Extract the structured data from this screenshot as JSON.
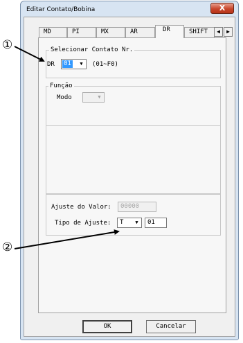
{
  "window": {
    "title": "Editar Contato/Bobina",
    "close_symbol": "X"
  },
  "tabs": [
    {
      "label": "MD",
      "active": false
    },
    {
      "label": "PI",
      "active": false
    },
    {
      "label": "MX",
      "active": false
    },
    {
      "label": "AR",
      "active": false
    },
    {
      "label": "DR",
      "active": true
    },
    {
      "label": "SHIFT",
      "active": false
    }
  ],
  "tab_scroll": {
    "left_icon": "◀",
    "right_icon": "▶"
  },
  "select_contact": {
    "legend": "Selecionar Contato Nr.",
    "prefix": "DR",
    "value": "01",
    "dropdown_icon": "▼",
    "range": "(01~F0)"
  },
  "function": {
    "legend": "Função",
    "mode_label": "Modo",
    "mode_value": "",
    "dropdown_icon": "▼"
  },
  "adjust": {
    "value_label": "Ajuste do Valor:",
    "value_placeholder": "00000",
    "type_label": "Tipo de Ajuste:",
    "type_value": "T",
    "type_dropdown_icon": "▼",
    "type_number": "01"
  },
  "buttons": {
    "ok": "OK",
    "cancel": "Cancelar"
  },
  "callouts": {
    "one": "①",
    "two": "②"
  }
}
